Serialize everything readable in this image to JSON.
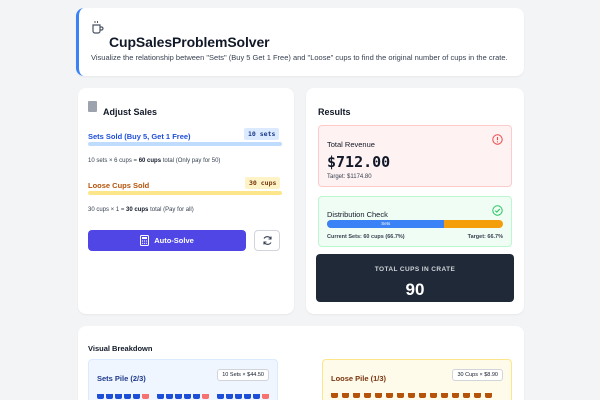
{
  "header": {
    "title": "CupSalesProblemSolver",
    "subtitle": "Visualize the relationship between \"Sets\" (Buy 5 Get 1 Free) and \"Loose\" cups to find the original number of cups in the crate."
  },
  "adjust": {
    "title": "Adjust Sales",
    "sets": {
      "label": "Sets Sold (Buy 5, Get 1 Free)",
      "value": "10 sets",
      "note_prefix": "10 sets × 6 cups =",
      "note_bold": "60 cups",
      "note_suffix": "total (Only pay for 50)"
    },
    "loose": {
      "label": "Loose Cups Sold",
      "value": "30 cups",
      "note_prefix": "30 cups × 1 =",
      "note_bold": "30 cups",
      "note_suffix": "total (Pay for all)"
    },
    "autosolve_label": "Auto-Solve"
  },
  "results": {
    "title": "Results",
    "revenue": {
      "label": "Total Revenue",
      "value": "$712.00",
      "target": "Target: $1174.80"
    },
    "distribution": {
      "label": "Distribution Check",
      "bar_label": "Sets",
      "sets_fraction": 0.667,
      "current": "Current Sets: 60 cups (66.7%)",
      "target": "Target: 66.7%"
    },
    "total": {
      "label": "TOTAL CUPS IN CRATE",
      "value": "90"
    }
  },
  "visual": {
    "title": "Visual Breakdown",
    "sets_pile": {
      "title": "Sets Pile (2/3)",
      "badge": "10 Sets × $44.50"
    },
    "loose_pile": {
      "title": "Loose Pile (1/3)",
      "badge": "30 Cups × $8.90"
    }
  },
  "colors": {
    "accent": "#3b82f6",
    "indigo": "#4f46e5",
    "sets_blue": "#1d4ed8",
    "loose_amber": "#b45309",
    "free_red": "#f87171",
    "success": "#22c55e",
    "danger": "#ef4444"
  },
  "icons": {
    "header": "cup-icon",
    "adjust": "document-icon",
    "autosolve": "calculator-icon",
    "refresh": "refresh-icon",
    "revenue": "alert-circle-icon",
    "distribution": "check-circle-icon"
  }
}
